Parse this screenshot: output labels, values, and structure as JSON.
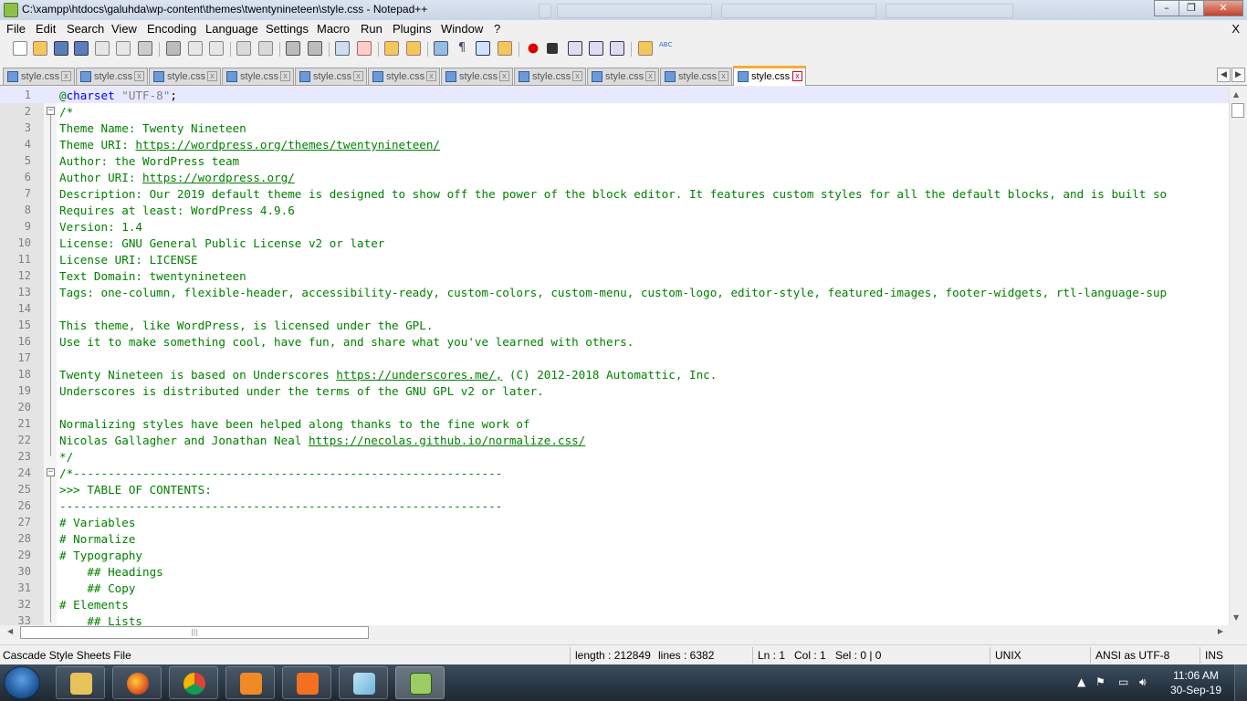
{
  "window": {
    "title": "C:\\xampp\\htdocs\\galuhda\\wp-content\\themes\\twentynineteen\\style.css - Notepad++",
    "minimize": "–",
    "maximize": "❐",
    "close": "✕"
  },
  "menu": {
    "items": [
      "File",
      "Edit",
      "Search",
      "View",
      "Encoding",
      "Language",
      "Settings",
      "Macro",
      "Run",
      "Plugins",
      "Window",
      "?"
    ],
    "close": "X"
  },
  "tabs": {
    "items": [
      {
        "label": "style.css",
        "active": false
      },
      {
        "label": "style.css",
        "active": false
      },
      {
        "label": "style.css",
        "active": false
      },
      {
        "label": "style.css",
        "active": false
      },
      {
        "label": "style.css",
        "active": false
      },
      {
        "label": "style.css",
        "active": false
      },
      {
        "label": "style.css",
        "active": false
      },
      {
        "label": "style.css",
        "active": false
      },
      {
        "label": "style.css",
        "active": false
      },
      {
        "label": "style.css",
        "active": false
      },
      {
        "label": "style.css",
        "active": true
      }
    ],
    "close_glyph": "x",
    "scroll_left": "◀",
    "scroll_right": "▶"
  },
  "editor": {
    "lines": [
      {
        "n": "1",
        "text": "@charset \"UTF-8\";"
      },
      {
        "n": "2",
        "text": "/*"
      },
      {
        "n": "3",
        "text": "Theme Name: Twenty Nineteen"
      },
      {
        "n": "4",
        "text": "Theme URI: https://wordpress.org/themes/twentynineteen/"
      },
      {
        "n": "5",
        "text": "Author: the WordPress team"
      },
      {
        "n": "6",
        "text": "Author URI: https://wordpress.org/"
      },
      {
        "n": "7",
        "text": "Description: Our 2019 default theme is designed to show off the power of the block editor. It features custom styles for all the default blocks, and is built so"
      },
      {
        "n": "8",
        "text": "Requires at least: WordPress 4.9.6"
      },
      {
        "n": "9",
        "text": "Version: 1.4"
      },
      {
        "n": "10",
        "text": "License: GNU General Public License v2 or later"
      },
      {
        "n": "11",
        "text": "License URI: LICENSE"
      },
      {
        "n": "12",
        "text": "Text Domain: twentynineteen"
      },
      {
        "n": "13",
        "text": "Tags: one-column, flexible-header, accessibility-ready, custom-colors, custom-menu, custom-logo, editor-style, featured-images, footer-widgets, rtl-language-sup"
      },
      {
        "n": "14",
        "text": ""
      },
      {
        "n": "15",
        "text": "This theme, like WordPress, is licensed under the GPL."
      },
      {
        "n": "16",
        "text": "Use it to make something cool, have fun, and share what you've learned with others."
      },
      {
        "n": "17",
        "text": ""
      },
      {
        "n": "18",
        "text": "Twenty Nineteen is based on Underscores https://underscores.me/, (C) 2012-2018 Automattic, Inc."
      },
      {
        "n": "19",
        "text": "Underscores is distributed under the terms of the GNU GPL v2 or later."
      },
      {
        "n": "20",
        "text": ""
      },
      {
        "n": "21",
        "text": "Normalizing styles have been helped along thanks to the fine work of"
      },
      {
        "n": "22",
        "text": "Nicolas Gallagher and Jonathan Neal https://necolas.github.io/normalize.css/"
      },
      {
        "n": "23",
        "text": "*/"
      },
      {
        "n": "24",
        "text": "/*--------------------------------------------------------------"
      },
      {
        "n": "25",
        "text": ">>> TABLE OF CONTENTS:"
      },
      {
        "n": "26",
        "text": "----------------------------------------------------------------"
      },
      {
        "n": "27",
        "text": "# Variables"
      },
      {
        "n": "28",
        "text": "# Normalize"
      },
      {
        "n": "29",
        "text": "# Typography"
      },
      {
        "n": "30",
        "text": "    ## Headings"
      },
      {
        "n": "31",
        "text": "    ## Copy"
      },
      {
        "n": "32",
        "text": "# Elements"
      },
      {
        "n": "33",
        "text": "    ## Lists"
      }
    ],
    "links": [
      "https://wordpress.org/themes/twentynineteen/",
      "https://wordpress.org/",
      "https://underscores.me/,",
      "https://necolas.github.io/normalize.css/"
    ],
    "colors": {
      "comment": "#008000",
      "keyword": "#0000ff",
      "string": "#808080",
      "current_line": "#e8e8ff"
    }
  },
  "status": {
    "file_type": "Cascade Style Sheets File",
    "length": "length : 212849",
    "lines": "lines : 6382",
    "ln": "Ln : 1",
    "col": "Col : 1",
    "sel": "Sel : 0 | 0",
    "eol": "UNIX",
    "encoding": "ANSI as UTF-8",
    "mode": "INS"
  },
  "taskbar": {
    "time": "11:06 AM",
    "date": "30-Sep-19",
    "apps": [
      "file-explorer",
      "firefox",
      "chrome",
      "pdf-reader",
      "xampp",
      "notepad",
      "notepad-plus-plus"
    ]
  }
}
